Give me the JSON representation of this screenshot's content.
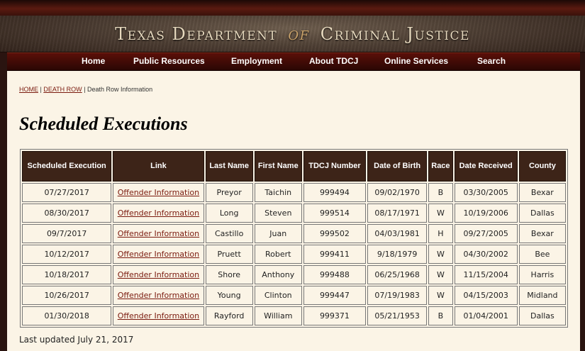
{
  "header": {
    "title_part1": "Texas Department",
    "title_of": "of",
    "title_part2": "Criminal Justice"
  },
  "nav": {
    "items": [
      "Home",
      "Public Resources",
      "Employment",
      "About TDCJ",
      "Online Services",
      "Search"
    ]
  },
  "breadcrumb": {
    "home": "HOME",
    "sep1": " | ",
    "death_row": "DEATH ROW",
    "sep2": " | ",
    "current": "Death Row Information"
  },
  "page_title": "Scheduled Executions",
  "table": {
    "headers": [
      "Scheduled Execution",
      "Link",
      "Last Name",
      "First Name",
      "TDCJ Number",
      "Date of Birth",
      "Race",
      "Date Received",
      "County"
    ],
    "rows": [
      [
        "07/27/2017",
        "Offender Information",
        "Preyor",
        "Taichin",
        "999494",
        "09/02/1970",
        "B",
        "03/30/2005",
        "Bexar"
      ],
      [
        "08/30/2017",
        "Offender Information",
        "Long",
        "Steven",
        "999514",
        "08/17/1971",
        "W",
        "10/19/2006",
        "Dallas"
      ],
      [
        "09/7/2017",
        "Offender Information",
        "Castillo",
        "Juan",
        "999502",
        "04/03/1981",
        "H",
        "09/27/2005",
        "Bexar"
      ],
      [
        "10/12/2017",
        "Offender Information",
        "Pruett",
        "Robert",
        "999411",
        "9/18/1979",
        "W",
        "04/30/2002",
        "Bee"
      ],
      [
        "10/18/2017",
        "Offender Information",
        "Shore",
        "Anthony",
        "999488",
        "06/25/1968",
        "W",
        "11/15/2004",
        "Harris"
      ],
      [
        "10/26/2017",
        "Offender Information",
        "Young",
        "Clinton",
        "999447",
        "07/19/1983",
        "W",
        "04/15/2003",
        "Midland"
      ],
      [
        "01/30/2018",
        "Offender Information",
        "Rayford",
        "William",
        "999371",
        "05/21/1953",
        "B",
        "01/04/2001",
        "Dallas"
      ]
    ]
  },
  "last_updated": "Last updated July 21, 2017",
  "colors": {
    "header_bg": "#4d3e33",
    "nav_bg": "#3a0804",
    "table_header_bg": "#3d2418",
    "content_bg": "#fbf4e6",
    "link": "#7a1a0e"
  }
}
